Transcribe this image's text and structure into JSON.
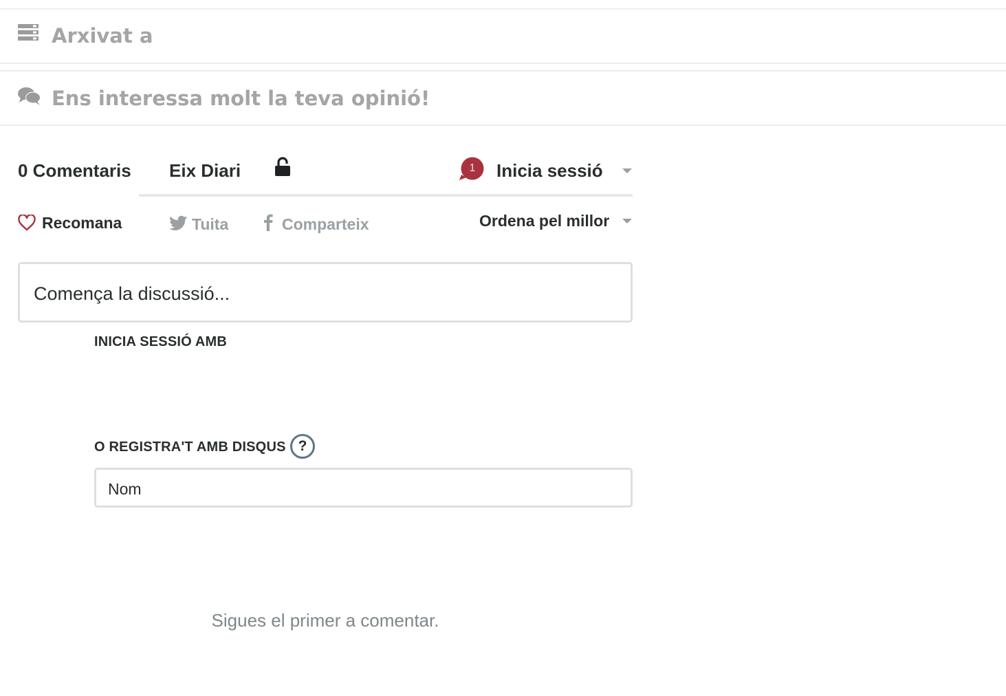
{
  "sections": {
    "archived_title": "Arxivat a",
    "opinion_title": "Ens interessa molt la teva opinió!"
  },
  "disqus": {
    "comments_count_label": "0 Comentaris",
    "community_name": "Eix Diari",
    "notification_count": "1",
    "login_label": "Inicia sessió",
    "recommend_label": "Recomana",
    "tweet_label": "Tuita",
    "share_label": "Comparteix",
    "sort_label": "Ordena pel millor",
    "compose_placeholder": "Comença la discussió...",
    "login_with_label": "INICIA SESSIÓ AMB",
    "register_label": "O REGISTRA'T AMB DISQUS",
    "help_symbol": "?",
    "name_placeholder": "Nom",
    "empty_message": "Sigues el primer a comentar."
  },
  "colors": {
    "accent_red": "#a8333f",
    "muted_gray": "#a5a5a5",
    "text_dark": "#2a2e2e",
    "divider": "#e7e9ee"
  }
}
